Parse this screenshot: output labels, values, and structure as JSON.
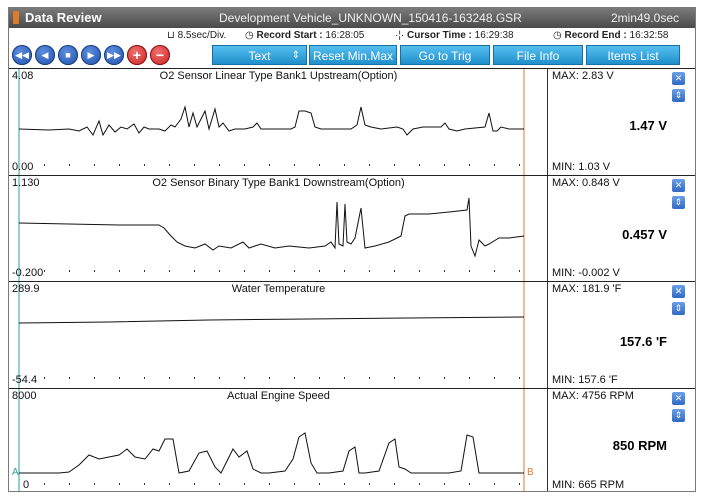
{
  "window": {
    "title": "Data Review",
    "file_name": "Development Vehicle_UNKNOWN_150416-163248.GSR",
    "duration": "2min49.0sec"
  },
  "info": {
    "time_div": "8.5sec/Div.",
    "record_start_label": "Record Start :",
    "record_start_value": "16:28:05",
    "cursor_time_label": "Cursor Time :",
    "cursor_time_value": "16:29:38",
    "record_end_label": "Record End :",
    "record_end_value": "16:32:58"
  },
  "toolbar": {
    "rewind_icon": "fast-backward",
    "prev_icon": "step-backward",
    "stop_icon": "stop",
    "play_icon": "play",
    "ffwd_icon": "fast-forward",
    "zoom_in_label": "+",
    "zoom_out_label": "−",
    "text_dropdown": "Text",
    "reset_label": "Reset Min.Max",
    "goto_trig_label": "Go to Trig",
    "file_info_label": "File Info",
    "items_list_label": "Items List"
  },
  "markers": {
    "a": "A",
    "b": "B"
  },
  "colors": {
    "title_bg": "#5a5a5a",
    "button_blue": "#1f8fcb",
    "cursor_line": "#e07a2a",
    "a_line": "#2aa0a0"
  },
  "panels": [
    {
      "name": "O2 Sensor Linear Type Bank1 Upstream(Option)",
      "scale_max": "4.08",
      "scale_min": "0.00",
      "max_text": "MAX:  2.83 V",
      "min_text": "MIN:  1.03 V",
      "current": "1.47 V"
    },
    {
      "name": "O2 Sensor Binary Type Bank1 Downstream(Option)",
      "scale_max": "1.130",
      "scale_min": "-0.200",
      "max_text": "MAX: 0.848 V",
      "min_text": "MIN: -0.002 V",
      "current": "0.457 V"
    },
    {
      "name": "Water Temperature",
      "scale_max": "289.9",
      "scale_min": "-54.4",
      "max_text": "MAX:  181.9 'F",
      "min_text": "MIN: 157.6 'F",
      "current": "157.6 'F"
    },
    {
      "name": "Actual Engine Speed",
      "scale_max": "8000",
      "scale_min": "0",
      "max_text": "MAX:   4756 RPM",
      "min_text": "MIN:   665 RPM",
      "current": "850 RPM"
    }
  ]
}
